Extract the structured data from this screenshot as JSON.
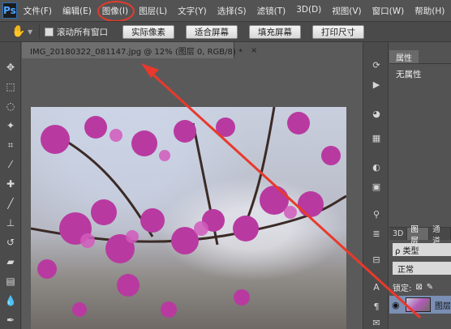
{
  "app": {
    "logo": "Ps"
  },
  "menu": [
    {
      "label": "文件(F)"
    },
    {
      "label": "编辑(E)"
    },
    {
      "label": "图像(I)"
    },
    {
      "label": "图层(L)"
    },
    {
      "label": "文字(Y)"
    },
    {
      "label": "选择(S)"
    },
    {
      "label": "滤镜(T)"
    },
    {
      "label": "3D(D)"
    },
    {
      "label": "视图(V)"
    },
    {
      "label": "窗口(W)"
    },
    {
      "label": "帮助(H)"
    }
  ],
  "options": {
    "scroll_all_label": "滚动所有窗口",
    "buttons": [
      "实际像素",
      "适合屏幕",
      "填充屏幕",
      "打印尺寸"
    ]
  },
  "document": {
    "tab_title": "IMG_20180322_081147.jpg @ 12% (图层 0, RGB/8) *",
    "close_glyph": "×"
  },
  "properties": {
    "tab": "属性",
    "empty_text": "无属性"
  },
  "layers": {
    "tabs": [
      "3D",
      "图层",
      "通道"
    ],
    "kind_label": "ρ 类型",
    "blend_mode": "正常",
    "lock_label": "锁定:",
    "layer_name": "图层"
  },
  "colors": {
    "accent_red": "#e8392c",
    "selected_layer": "#7a8fb3",
    "blossom": "#b83aa0"
  }
}
